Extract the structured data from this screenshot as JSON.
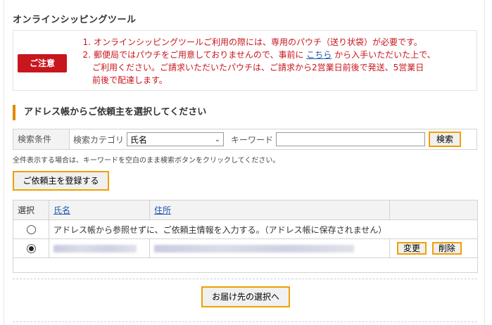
{
  "page_title": "オンラインシッピングツール",
  "notice": {
    "badge": "ご注意",
    "item1_num": "1.",
    "item1_text": "オンラインシッピングツールご利用の際には、専用のパウチ（送り状袋）が必要です。",
    "item2_num": "2.",
    "item2_pre": "郵便局ではパウチをご用意しておりませんので、事前に",
    "item2_link": "こちら",
    "item2_post": "から入手いただいた上で、",
    "item2_line2": "ご利用ください。ご請求いただいたパウチは、ご請求から2営業日前後で発送、5営業日",
    "item2_line3": "前後で配達します。"
  },
  "section_title": "アドレス帳からご依頼主を選択してください",
  "search": {
    "condition_label": "検索条件",
    "category_label": "検索カテゴリ",
    "category_selected": "氏名",
    "keyword_label": "キーワード",
    "keyword_value": "",
    "button_label": "検索"
  },
  "hint": "全件表示する場合は、キーワードを空白のまま検索ボタンをクリックしてください。",
  "register_button": "ご依頼主を登録する",
  "table": {
    "headers": {
      "select": "選択",
      "name": "氏名",
      "address": "住所"
    },
    "row1_text": "アドレス帳から参照せずに、ご依頼主情報を入力する。（アドレス帳に保存されません）",
    "row2": {
      "edit": "変更",
      "delete": "削除"
    }
  },
  "next_button": "お届け先の選択へ"
}
